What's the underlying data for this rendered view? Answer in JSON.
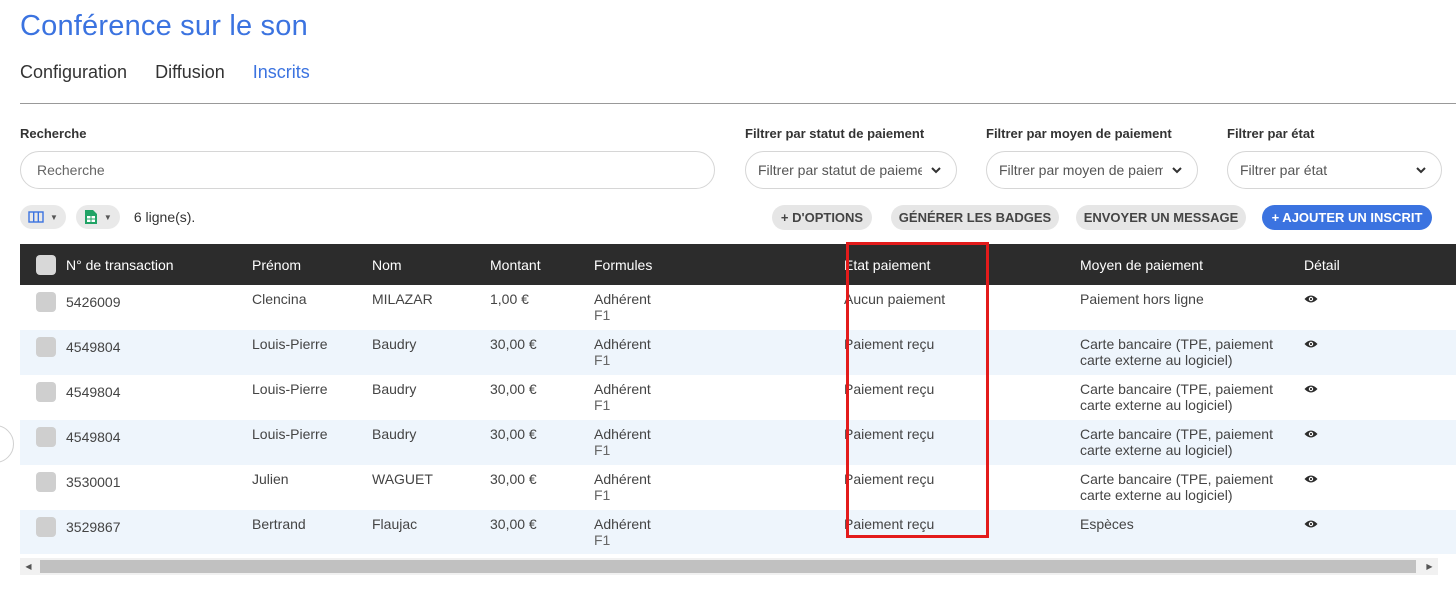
{
  "page": {
    "title": "Conférence sur le son"
  },
  "tabs": [
    {
      "label": "Configuration",
      "active": false
    },
    {
      "label": "Diffusion",
      "active": false
    },
    {
      "label": "Inscrits",
      "active": true
    }
  ],
  "filters": {
    "search": {
      "label": "Recherche",
      "placeholder": "Recherche"
    },
    "payment_status": {
      "label": "Filtrer par statut de paiement",
      "value": "Filtrer par statut de paiement"
    },
    "payment_method": {
      "label": "Filtrer par moyen de paiement",
      "value": "Filtrer par moyen de paiement"
    },
    "state": {
      "label": "Filtrer par état",
      "value": "Filtrer par état"
    }
  },
  "toolbar": {
    "row_count": "6 ligne(s).",
    "more_options": "+ D'OPTIONS",
    "generate_badges": "GÉNÉRER LES BADGES",
    "send_message": "ENVOYER UN MESSAGE",
    "add_registrant": "+ AJOUTER UN INSCRIT"
  },
  "table": {
    "headers": [
      "N° de transaction",
      "Prénom",
      "Nom",
      "Montant",
      "Formules",
      "Etat paiement",
      "Moyen de paiement",
      "Détail"
    ],
    "rows": [
      {
        "transaction": "5426009",
        "prenom": "Clencina",
        "nom": "MILAZAR",
        "montant": "1,00 €",
        "formule": "Adhérent",
        "formule_sub": "F1",
        "etat": "Aucun paiement",
        "moyen": "Paiement hors ligne",
        "moyen_sub": ""
      },
      {
        "transaction": "4549804",
        "prenom": "Louis-Pierre",
        "nom": "Baudry",
        "montant": "30,00 €",
        "formule": "Adhérent",
        "formule_sub": "F1",
        "etat": "Paiement reçu",
        "moyen": "Carte bancaire (TPE, paiement",
        "moyen_sub": "carte externe au logiciel)"
      },
      {
        "transaction": "4549804",
        "prenom": "Louis-Pierre",
        "nom": "Baudry",
        "montant": "30,00 €",
        "formule": "Adhérent",
        "formule_sub": "F1",
        "etat": "Paiement reçu",
        "moyen": "Carte bancaire (TPE, paiement",
        "moyen_sub": "carte externe au logiciel)"
      },
      {
        "transaction": "4549804",
        "prenom": "Louis-Pierre",
        "nom": "Baudry",
        "montant": "30,00 €",
        "formule": "Adhérent",
        "formule_sub": "F1",
        "etat": "Paiement reçu",
        "moyen": "Carte bancaire (TPE, paiement",
        "moyen_sub": "carte externe au logiciel)"
      },
      {
        "transaction": "3530001",
        "prenom": "Julien",
        "nom": "WAGUET",
        "montant": "30,00 €",
        "formule": "Adhérent",
        "formule_sub": "F1",
        "etat": "Paiement reçu",
        "moyen": "Carte bancaire (TPE, paiement",
        "moyen_sub": "carte externe au logiciel)"
      },
      {
        "transaction": "3529867",
        "prenom": "Bertrand",
        "nom": "Flaujac",
        "montant": "30,00 €",
        "formule": "Adhérent",
        "formule_sub": "F1",
        "etat": "Paiement reçu",
        "moyen": "Espèces",
        "moyen_sub": ""
      }
    ]
  },
  "icons": {
    "columns": "columns-icon",
    "export": "spreadsheet-export-icon",
    "detail": "eye-icon",
    "chevron": "chevron-down-icon"
  },
  "colors": {
    "accent": "#3b73e0",
    "header_bg": "#2c2c2c",
    "highlight": "#e31b1b",
    "export_green": "#21a366"
  }
}
